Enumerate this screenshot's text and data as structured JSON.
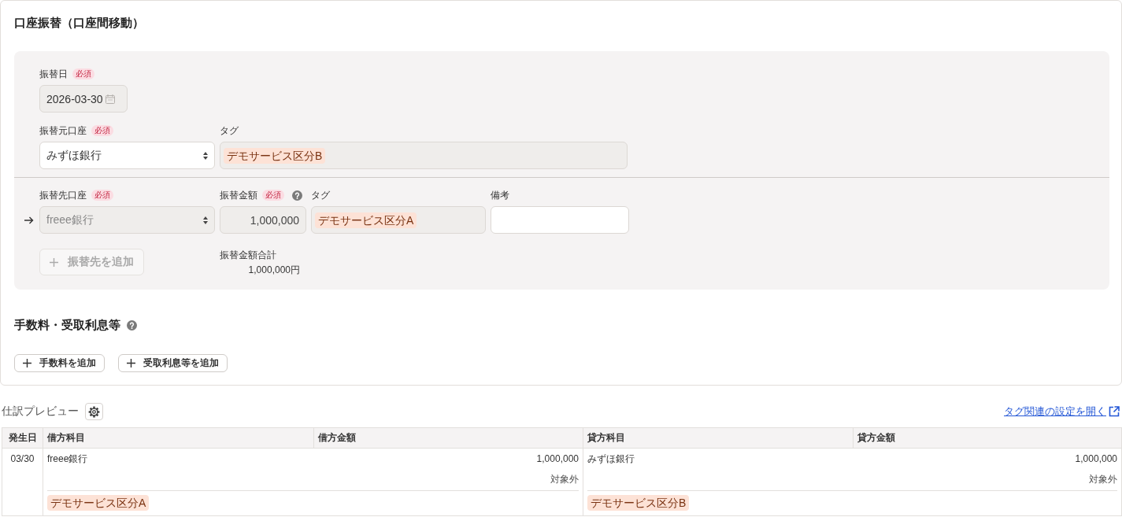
{
  "header": {
    "title": "口座振替（口座間移動）"
  },
  "transfer_panel": {
    "date_field": {
      "label": "振替日",
      "required_badge": "必須",
      "value": "2026-03-30",
      "disabled": true
    },
    "source": {
      "account_field": {
        "label": "振替元口座",
        "required_badge": "必須",
        "value": "みずほ銀行",
        "disabled": false
      },
      "tag_field": {
        "label": "タグ",
        "tags": [
          "デモサービス区分B"
        ],
        "disabled": true
      }
    },
    "destinations": [
      {
        "account_field": {
          "label": "振替先口座",
          "required_badge": "必須",
          "value": "freee銀行",
          "disabled": true
        },
        "amount_field": {
          "label": "振替金額",
          "required_badge": "必須",
          "value": "1,000,000",
          "disabled": true
        },
        "tag_field": {
          "label": "タグ",
          "tags": [
            "デモサービス区分A"
          ],
          "disabled": true
        },
        "memo_field": {
          "label": "備考",
          "disabled": false
        }
      }
    ],
    "add_destination_button": {
      "label": "振替先を追加",
      "disabled": true
    },
    "total": {
      "label": "振替金額合計",
      "value": "1,000,000円"
    }
  },
  "fees_section": {
    "title": "手数料・受取利息等",
    "buttons": [
      {
        "label": "手数料を追加",
        "disabled": false
      },
      {
        "label": "受取利息等を追加",
        "disabled": false
      }
    ]
  },
  "journal_preview": {
    "title": "仕訳プレビュー",
    "settings_link": "タグ関連の設定を開く",
    "table": {
      "columns": [
        "発生日",
        "借方科目",
        "借方金額",
        "貸方科目",
        "貸方金額"
      ],
      "rows": [
        {
          "date": "03/30",
          "debit": {
            "account": "freee銀行",
            "amount": "1,000,000",
            "tax": "対象外",
            "tags": [
              "デモサービス区分A"
            ]
          },
          "credit": {
            "account": "みずほ銀行",
            "amount": "1,000,000",
            "tax": "対象外",
            "tags": [
              "デモサービス区分B"
            ]
          }
        }
      ]
    }
  }
}
